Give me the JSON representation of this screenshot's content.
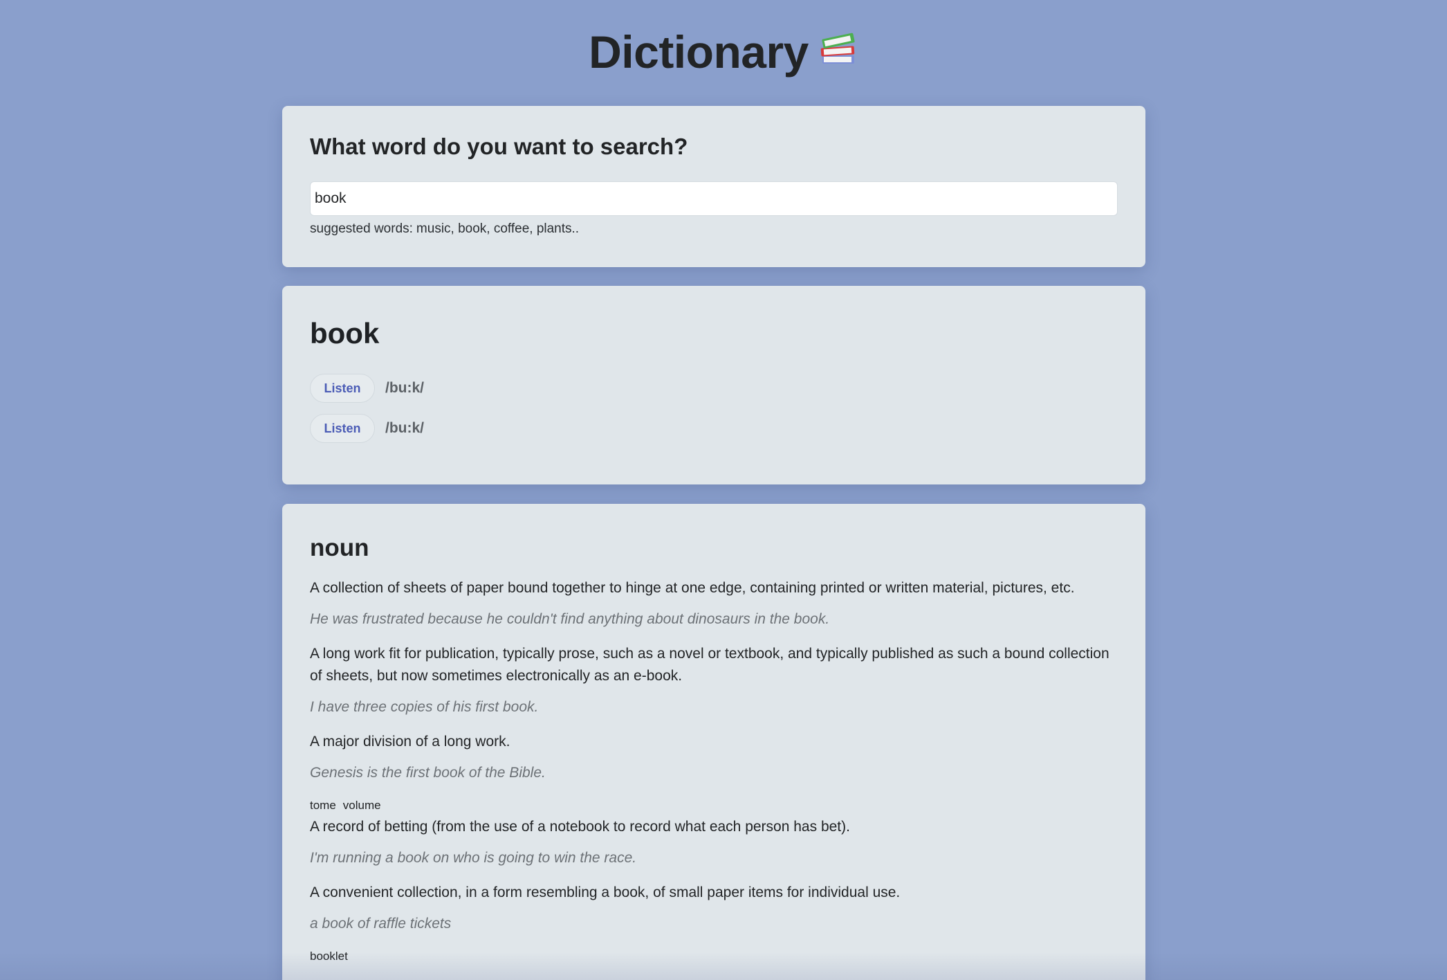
{
  "app": {
    "title": "Dictionary",
    "icon": "books-icon"
  },
  "search": {
    "heading": "What word do you want to search?",
    "value": "book",
    "hint_label": "suggested words:",
    "hint_words": "music, book, coffee, plants.."
  },
  "word": {
    "text": "book",
    "phonetics": [
      {
        "button_label": "Listen",
        "text": "/bu:k/"
      },
      {
        "button_label": "Listen",
        "text": "/bu:k/"
      }
    ]
  },
  "meaning": {
    "part_of_speech": "noun",
    "definitions": [
      {
        "definition": "A collection of sheets of paper bound together to hinge at one edge, containing printed or written material, pictures, etc.",
        "example": "He was frustrated because he couldn't find anything about dinosaurs in the book."
      },
      {
        "definition": "A long work fit for publication, typically prose, such as a novel or textbook, and typically published as such a bound collection of sheets, but now sometimes electronically as an e-book.",
        "example": "I have three copies of his first book."
      },
      {
        "definition": "A major division of a long work.",
        "example": "Genesis is the first book of the Bible.",
        "synonyms": [
          "tome",
          "volume"
        ]
      },
      {
        "definition": "A record of betting (from the use of a notebook to record what each person has bet).",
        "example": "I'm running a book on who is going to win the race."
      },
      {
        "definition": "A convenient collection, in a form resembling a book, of small paper items for individual use.",
        "example": "a book of raffle tickets",
        "synonyms": [
          "booklet"
        ]
      }
    ]
  },
  "colors": {
    "background": "#8a9fcc",
    "card": "#e0e6ea",
    "accent": "#4a5bb5",
    "muted": "#6c7176"
  }
}
